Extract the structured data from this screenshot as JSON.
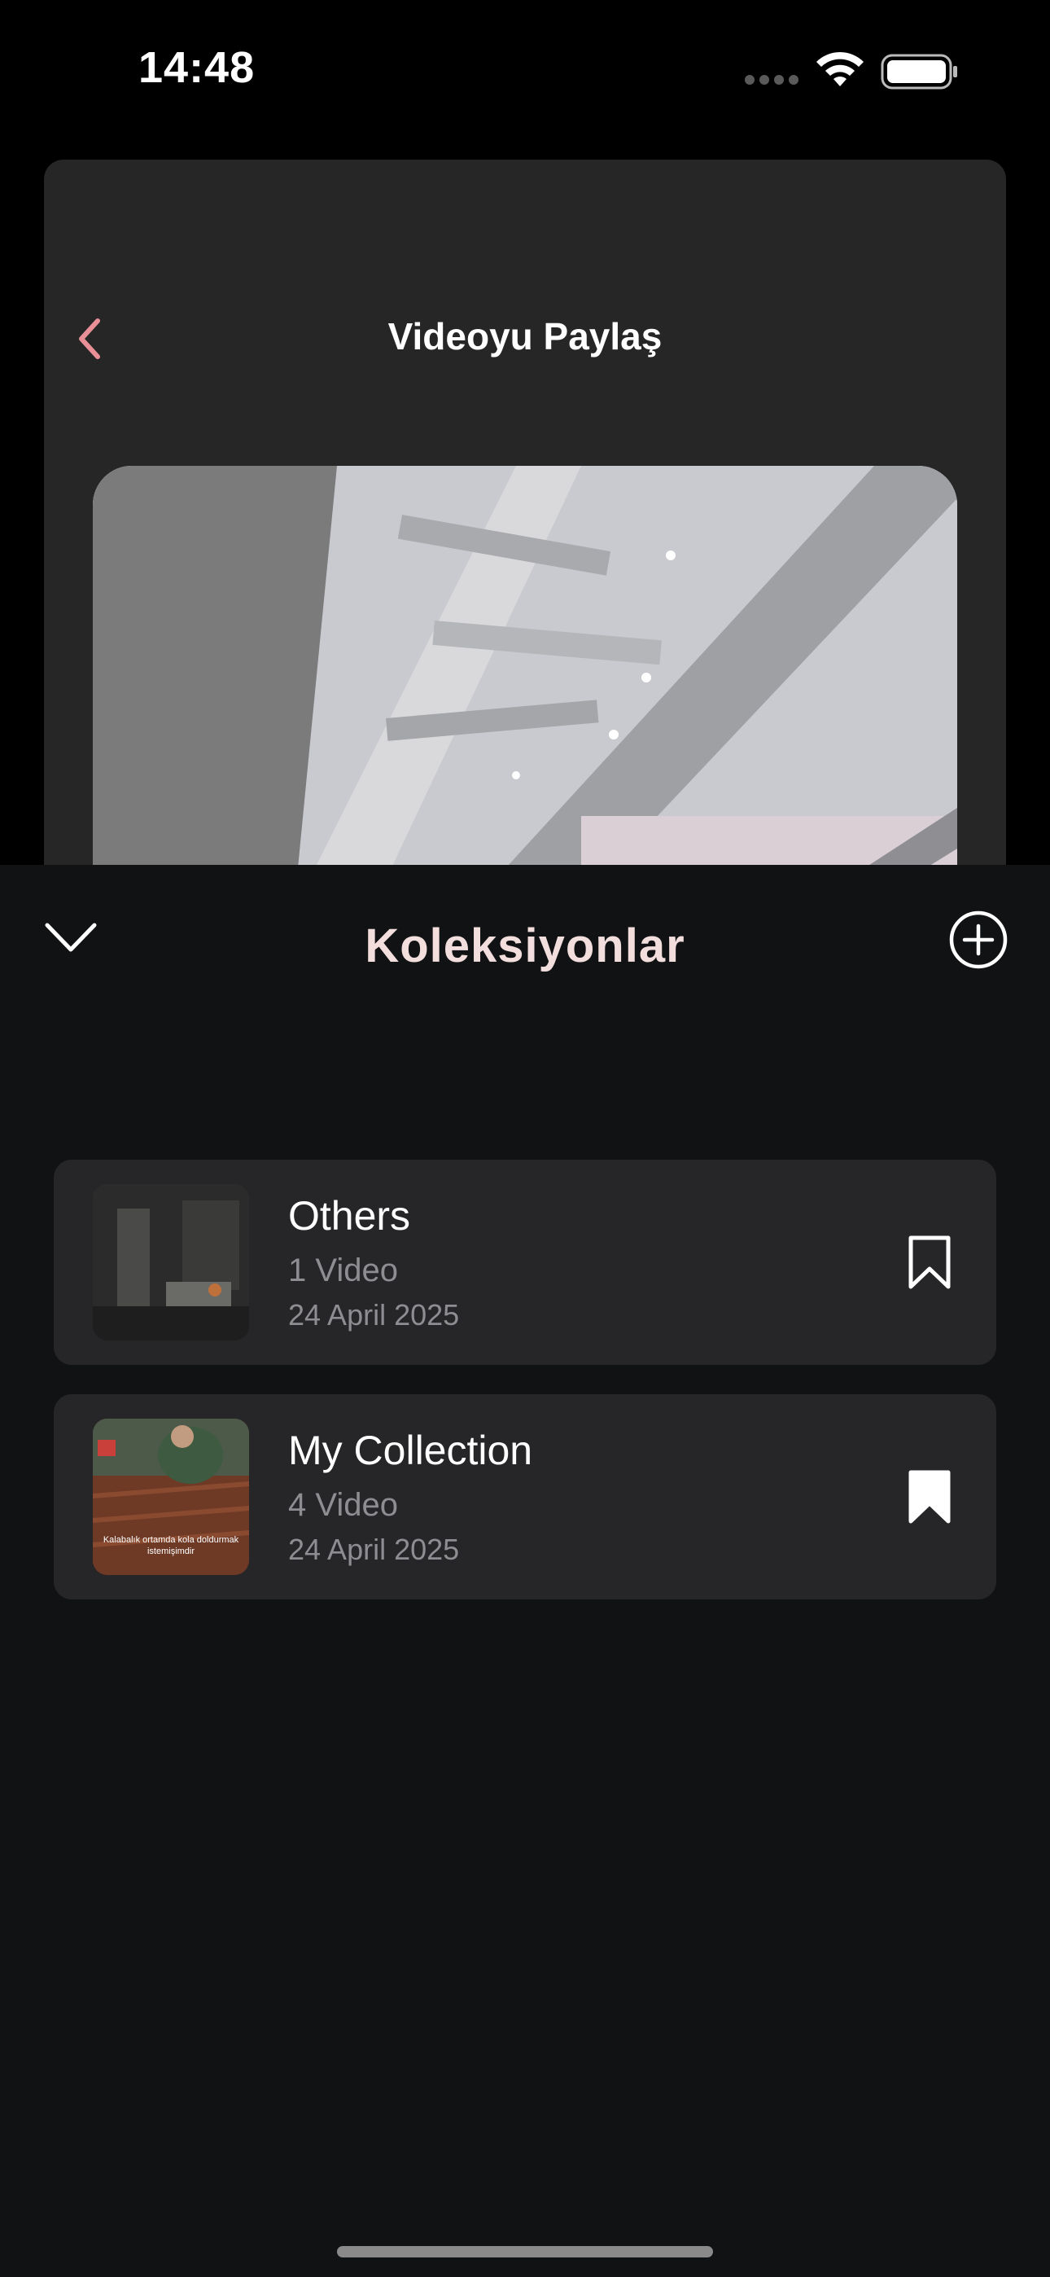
{
  "status_bar": {
    "time": "14:48"
  },
  "share_screen": {
    "title": "Videoyu Paylaş",
    "back_icon": "chevron-left-icon"
  },
  "collections_sheet": {
    "title": "Koleksiyonlar",
    "collapse_icon": "chevron-down-icon",
    "add_icon": "plus-circle-icon",
    "items": [
      {
        "name": "Others",
        "count": "1 Video",
        "date": "24 April 2025",
        "bookmark": "bookmark-outline-icon"
      },
      {
        "name": "My Collection",
        "count": "4 Video",
        "date": "24 April 2025",
        "thumbnail_caption": "Kalabalık ortamda kola doldurmak istemişimdir",
        "bookmark": "bookmark-filled-icon"
      }
    ]
  },
  "colors": {
    "accent": "#e88f98",
    "sheet_title": "#f3dede",
    "background": "#111214",
    "card": "#262629"
  }
}
